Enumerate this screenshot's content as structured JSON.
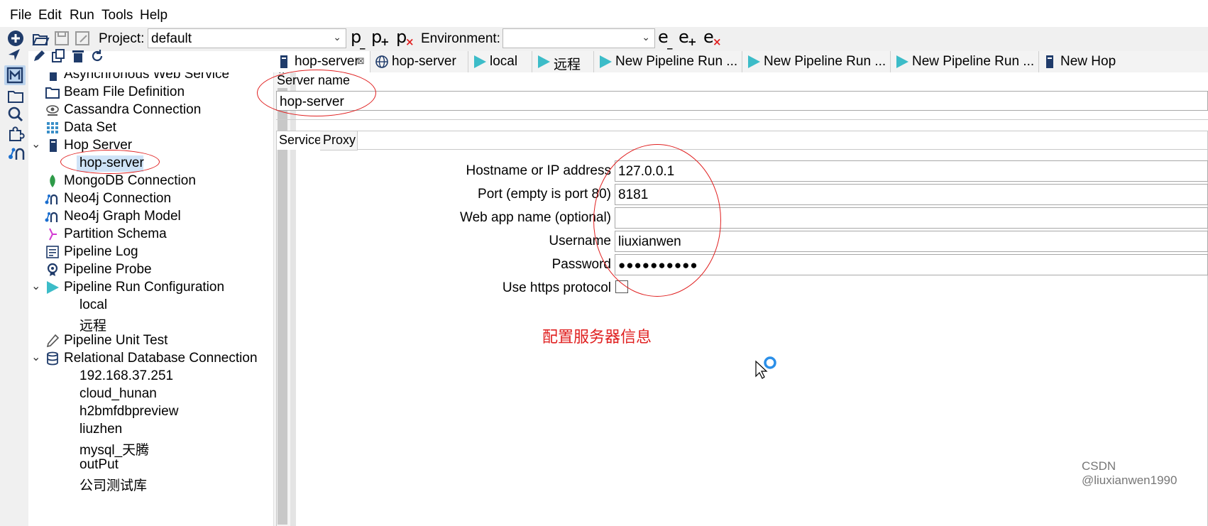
{
  "menubar": {
    "items": [
      "File",
      "Edit",
      "Run",
      "Tools",
      "Help"
    ]
  },
  "toolbar": {
    "project_label": "Project:",
    "project_value": "default",
    "environment_label": "Environment:",
    "environment_value": "",
    "pipeline_buttons": [
      "p",
      "p",
      "p"
    ],
    "environment_buttons": [
      "e",
      "e",
      "e"
    ]
  },
  "tree": {
    "items": [
      {
        "label": "Asynchronous Web Service",
        "icon": "web-service-icon"
      },
      {
        "label": "Beam File Definition",
        "icon": "folder-icon"
      },
      {
        "label": "Cassandra Connection",
        "icon": "cassandra-icon"
      },
      {
        "label": "Data Set",
        "icon": "dataset-icon"
      },
      {
        "label": "Hop Server",
        "icon": "server-icon"
      },
      {
        "label": "hop-server"
      },
      {
        "label": "MongoDB Connection",
        "icon": "mongodb-icon"
      },
      {
        "label": "Neo4j Connection",
        "icon": "neo4j-icon"
      },
      {
        "label": "Neo4j Graph Model",
        "icon": "neo4j-icon"
      },
      {
        "label": "Partition Schema",
        "icon": "partition-icon"
      },
      {
        "label": "Pipeline Log",
        "icon": "log-icon"
      },
      {
        "label": "Pipeline Probe",
        "icon": "probe-icon"
      },
      {
        "label": "Pipeline Run Configuration",
        "icon": "play-icon"
      },
      {
        "label": "local"
      },
      {
        "label": "远程"
      },
      {
        "label": "Pipeline Unit Test",
        "icon": "test-icon"
      },
      {
        "label": "Relational Database Connection",
        "icon": "database-icon"
      },
      {
        "label": "192.168.37.251"
      },
      {
        "label": "cloud_hunan"
      },
      {
        "label": "h2bmfdbpreview"
      },
      {
        "label": "liuzhen"
      },
      {
        "label": "mysql_天腾"
      },
      {
        "label": "outPut"
      },
      {
        "label": "公司测试库"
      }
    ]
  },
  "tabs": [
    {
      "label": "hop-server",
      "close": "⊠"
    },
    {
      "label": "hop-server"
    },
    {
      "label": "local"
    },
    {
      "label": "远程"
    },
    {
      "label": "New Pipeline Run ..."
    },
    {
      "label": "New Pipeline Run ..."
    },
    {
      "label": "New Pipeline Run ..."
    },
    {
      "label": "New Hop"
    }
  ],
  "editor": {
    "server_name_label": "Server name",
    "server_name_value": "hop-server",
    "subtabs": [
      "Service",
      "Proxy"
    ],
    "fields": [
      {
        "label": "Hostname or IP address",
        "value": "127.0.0.1"
      },
      {
        "label": "Port (empty is port 80)",
        "value": "8181"
      },
      {
        "label": "Web app name (optional)",
        "value": ""
      },
      {
        "label": "Username",
        "value": "liuxianwen"
      },
      {
        "label": "Password",
        "value": "●●●●●●●●●●"
      }
    ],
    "https_label": "Use https protocol",
    "https_checked": false
  },
  "annotation": "配置服务器信息",
  "watermark": "CSDN @liuxianwen1990",
  "colors": {
    "annotation": "#e02020",
    "teal_play": "#3cbcc8",
    "neo4j_blue": "#1a6ecf"
  }
}
